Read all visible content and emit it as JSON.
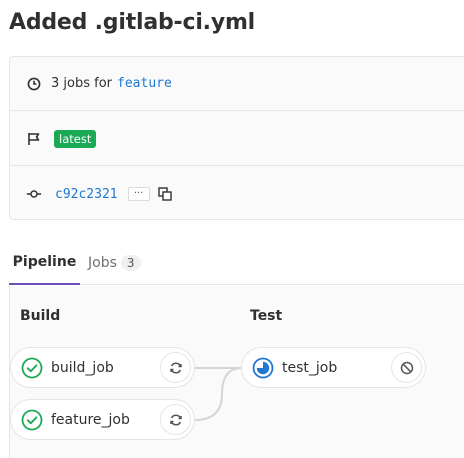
{
  "page": {
    "title": "Added .gitlab-ci.yml"
  },
  "info": {
    "jobs_text": "3 jobs for",
    "branch": "feature",
    "badge": "latest",
    "commit_sha": "c92c2321",
    "ellipsis": "···"
  },
  "tabs": [
    {
      "label": "Pipeline",
      "active": true
    },
    {
      "label": "Jobs",
      "count": "3",
      "active": false
    }
  ],
  "stages": [
    {
      "title": "Build",
      "jobs": [
        {
          "name": "build_job",
          "status": "success",
          "action": "retry-icon"
        },
        {
          "name": "feature_job",
          "status": "success",
          "action": "retry-icon"
        }
      ]
    },
    {
      "title": "Test",
      "jobs": [
        {
          "name": "test_job",
          "status": "running",
          "action": "cancel-icon"
        }
      ]
    }
  ],
  "colors": {
    "success": "#1aaa55",
    "running": "#1f78d1",
    "tab_active": "#6b4fbb",
    "link": "#1f78d1"
  }
}
